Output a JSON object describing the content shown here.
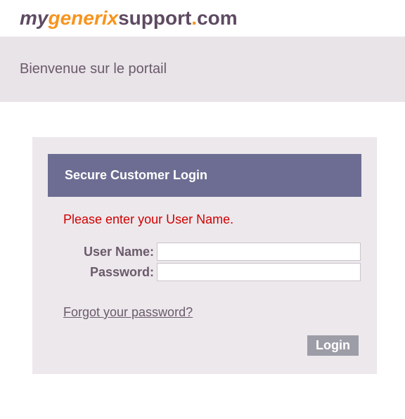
{
  "logo": {
    "part1": "my",
    "part2": "generix",
    "part3": "support",
    "part4": ".",
    "part5": "com"
  },
  "welcome": "Bienvenue sur le portail",
  "login": {
    "title": "Secure Customer Login",
    "error": "Please enter your User Name.",
    "username_label": "User Name:",
    "password_label": "Password:",
    "username_value": "",
    "password_value": "",
    "forgot_link": "Forgot your password?",
    "button": "Login"
  }
}
